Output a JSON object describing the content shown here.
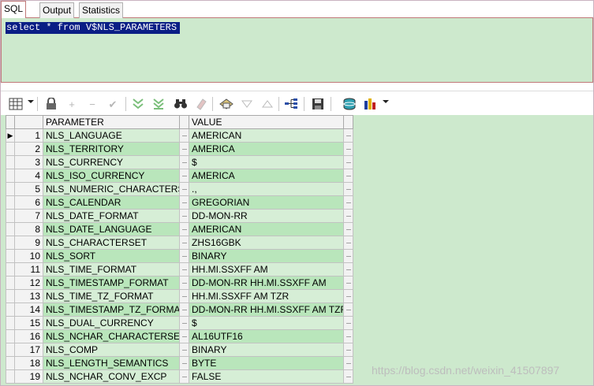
{
  "tabs": [
    {
      "label": "SQL"
    },
    {
      "label": "Output"
    },
    {
      "label": "Statistics"
    }
  ],
  "editor": {
    "sql": "select * from V$NLS_PARAMETERS"
  },
  "toolbar": {
    "icons": [
      "grid-view-icon",
      "lock-icon",
      "add-row-icon",
      "delete-row-icon",
      "post-check-icon",
      "fetch-next-icon",
      "fetch-last-icon",
      "find-binoculars-icon",
      "clear-eraser-icon",
      "query-by-example-icon",
      "filter-down-icon",
      "filter-up-icon",
      "tree-view-icon",
      "save-disk-icon",
      "export-database-icon",
      "chart-bars-icon"
    ]
  },
  "grid": {
    "columns": [
      "PARAMETER",
      "VALUE"
    ],
    "cell_button_glyph": "···",
    "current_row_marker": "▶",
    "rows": [
      {
        "num": "1",
        "parameter": "NLS_LANGUAGE",
        "value": "AMERICAN"
      },
      {
        "num": "2",
        "parameter": "NLS_TERRITORY",
        "value": "AMERICA"
      },
      {
        "num": "3",
        "parameter": "NLS_CURRENCY",
        "value": "$"
      },
      {
        "num": "4",
        "parameter": "NLS_ISO_CURRENCY",
        "value": "AMERICA"
      },
      {
        "num": "5",
        "parameter": "NLS_NUMERIC_CHARACTERS",
        "value": ".,"
      },
      {
        "num": "6",
        "parameter": "NLS_CALENDAR",
        "value": "GREGORIAN"
      },
      {
        "num": "7",
        "parameter": "NLS_DATE_FORMAT",
        "value": "DD-MON-RR"
      },
      {
        "num": "8",
        "parameter": "NLS_DATE_LANGUAGE",
        "value": "AMERICAN"
      },
      {
        "num": "9",
        "parameter": "NLS_CHARACTERSET",
        "value": "ZHS16GBK"
      },
      {
        "num": "10",
        "parameter": "NLS_SORT",
        "value": "BINARY"
      },
      {
        "num": "11",
        "parameter": "NLS_TIME_FORMAT",
        "value": "HH.MI.SSXFF AM"
      },
      {
        "num": "12",
        "parameter": "NLS_TIMESTAMP_FORMAT",
        "value": "DD-MON-RR HH.MI.SSXFF AM"
      },
      {
        "num": "13",
        "parameter": "NLS_TIME_TZ_FORMAT",
        "value": "HH.MI.SSXFF AM TZR"
      },
      {
        "num": "14",
        "parameter": "NLS_TIMESTAMP_TZ_FORMAT",
        "value": "DD-MON-RR HH.MI.SSXFF AM TZR"
      },
      {
        "num": "15",
        "parameter": "NLS_DUAL_CURRENCY",
        "value": "$"
      },
      {
        "num": "16",
        "parameter": "NLS_NCHAR_CHARACTERSET",
        "value": "AL16UTF16"
      },
      {
        "num": "17",
        "parameter": "NLS_COMP",
        "value": "BINARY"
      },
      {
        "num": "18",
        "parameter": "NLS_LENGTH_SEMANTICS",
        "value": "BYTE"
      },
      {
        "num": "19",
        "parameter": "NLS_NCHAR_CONV_EXCP",
        "value": "FALSE"
      }
    ]
  },
  "watermark": "https://blog.csdn.net/weixin_41507897",
  "colors": {
    "editor_bg": "#cde9cd",
    "row_even": "#b9e6bb",
    "row_odd": "#d6eed6",
    "selection": "#0a1e85"
  }
}
